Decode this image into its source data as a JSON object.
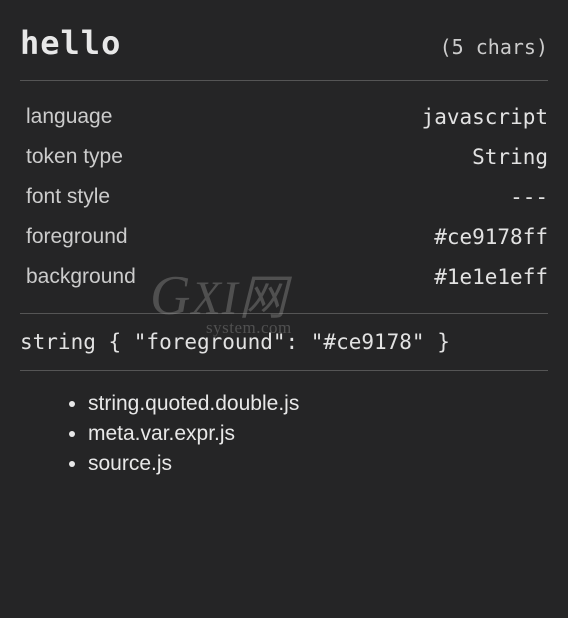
{
  "header": {
    "token": "hello",
    "count": "(5 chars)"
  },
  "properties": {
    "language": {
      "label": "language",
      "value": "javascript"
    },
    "tokenType": {
      "label": "token type",
      "value": "String"
    },
    "fontStyle": {
      "label": "font style",
      "value": "---"
    },
    "foreground": {
      "label": "foreground",
      "value": "#ce9178ff"
    },
    "background": {
      "label": "background",
      "value": "#1e1e1eff"
    }
  },
  "rule": "string { \"foreground\": \"#ce9178\" }",
  "scopes": [
    "string.quoted.double.js",
    "meta.var.expr.js",
    "source.js"
  ],
  "watermark": {
    "main": "GXI网",
    "sub": "system.com"
  }
}
